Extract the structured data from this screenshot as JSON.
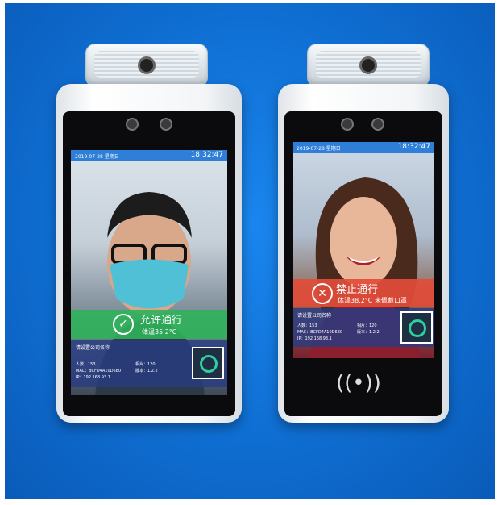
{
  "devices": [
    {
      "id": "left",
      "status_date": "2019-07-28 星期日",
      "status_time": "18:32:47",
      "banner_title": "允许通行",
      "banner_sub": "体温35.2°C",
      "banner_icon": "check-icon",
      "banner_color": "#2fb35a",
      "company": "请设置公司名称",
      "info_lines": [
        "人数：153",
        "MAC：BCFD4A10D6E0",
        "IP：192.168.93.1"
      ],
      "info_lines_right": [
        "相片：120",
        "版本：1.2.2"
      ]
    },
    {
      "id": "right",
      "status_date": "2019-07-28 星期日",
      "status_time": "18:32:47",
      "banner_title": "禁止通行",
      "banner_sub": "体温38.2°C 未佩戴口罩",
      "banner_icon": "x-icon",
      "banner_color": "#e24c3a",
      "company": "请设置公司名称",
      "info_lines": [
        "人数：153",
        "MAC：BCFD4A10D6E0",
        "IP：192.168.93.1"
      ],
      "info_lines_right": [
        "相片：120",
        "版本：1.2.2"
      ],
      "nfc_symbol": "((•))"
    }
  ]
}
